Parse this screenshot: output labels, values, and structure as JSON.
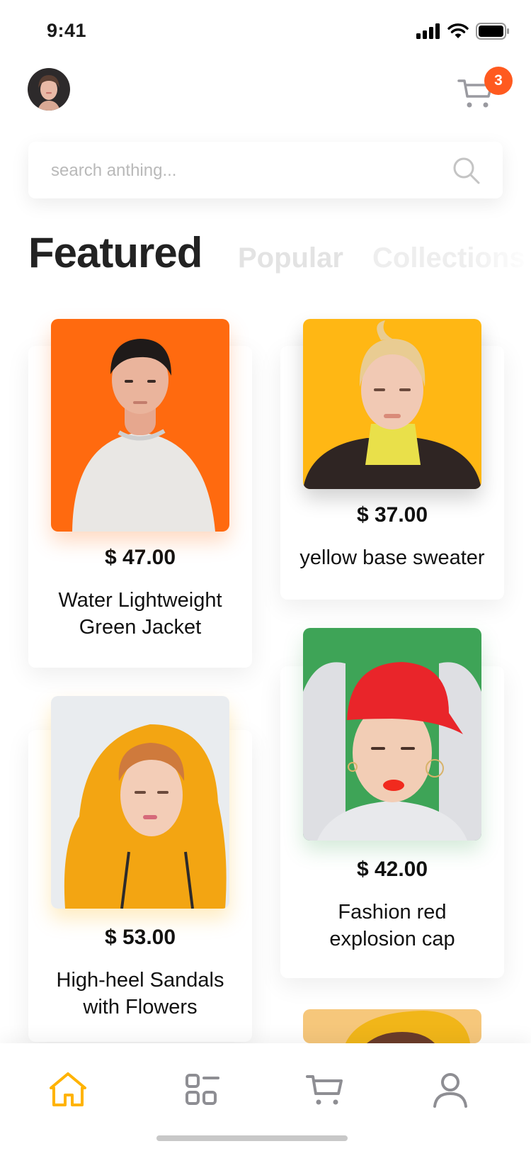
{
  "status_bar": {
    "time": "9:41"
  },
  "header": {
    "cart_count": "3"
  },
  "search": {
    "placeholder": "search anthing..."
  },
  "tabs": [
    {
      "label": "Featured",
      "active": true
    },
    {
      "label": "Popular",
      "active": false
    },
    {
      "label": "Collections",
      "active": false
    }
  ],
  "products": [
    {
      "price": "$ 47.00",
      "name_line1": "Water Lightweight",
      "name_line2": "Green Jacket",
      "image_bg": "#ff6a0f"
    },
    {
      "price": "$ 37.00",
      "name_line1": "yellow base sweater",
      "name_line2": "",
      "image_bg": "#ffb714"
    },
    {
      "price": "$ 53.00",
      "name_line1": "High-heel Sandals",
      "name_line2": "with Flowers",
      "image_bg": "#e9ecef"
    },
    {
      "price": "$ 42.00",
      "name_line1": "Fashion red",
      "name_line2": "explosion cap",
      "image_bg": "#3ea457"
    }
  ],
  "bottom_nav": [
    {
      "icon": "home-icon",
      "active": true
    },
    {
      "icon": "grid-icon",
      "active": false
    },
    {
      "icon": "cart-icon",
      "active": false
    },
    {
      "icon": "user-icon",
      "active": false
    }
  ],
  "colors": {
    "accent": "#ffb300",
    "badge": "#ff5a1f",
    "tab_active": "#222222",
    "tab_inactive": "#e3e3e3"
  }
}
